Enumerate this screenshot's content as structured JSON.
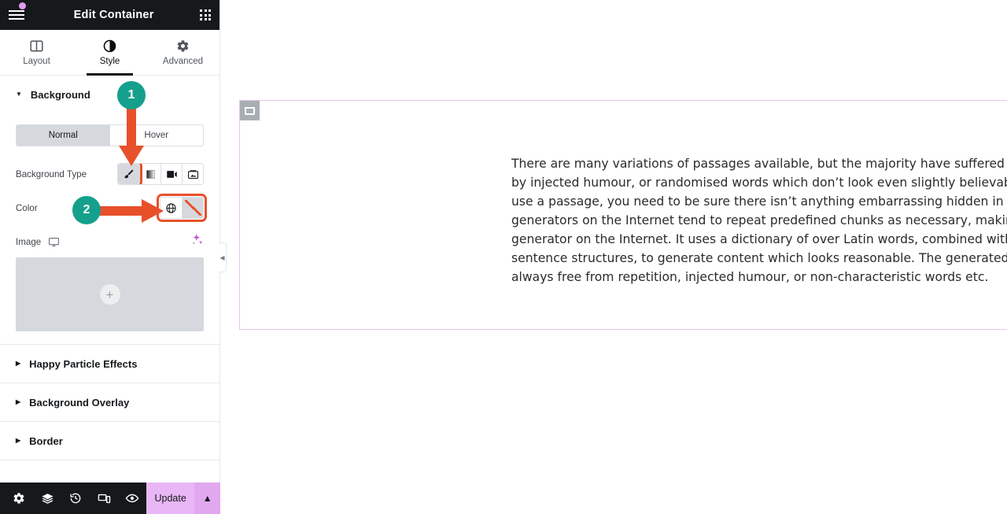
{
  "panel": {
    "header": {
      "title": "Edit Container",
      "menu_icon": "hamburger-menu-icon",
      "notification_dot_color": "#e39ded",
      "apps_icon": "grid-apps-icon"
    },
    "tabs": [
      {
        "label": "Layout",
        "icon": "layout-columns-icon",
        "active": false
      },
      {
        "label": "Style",
        "icon": "half-circle-contrast-icon",
        "active": true
      },
      {
        "label": "Advanced",
        "icon": "gear-icon",
        "active": false
      }
    ],
    "sections": [
      {
        "label": "Background",
        "expanded": true
      },
      {
        "label": "Happy Particle Effects",
        "expanded": false
      },
      {
        "label": "Background Overlay",
        "expanded": false
      },
      {
        "label": "Border",
        "expanded": false
      }
    ],
    "background": {
      "state_switch": {
        "options": [
          "Normal",
          "Hover"
        ],
        "selected": "Normal"
      },
      "background_type": {
        "label": "Background Type",
        "options": [
          {
            "name": "classic",
            "icon": "paint-brush-icon",
            "selected": true
          },
          {
            "name": "gradient",
            "icon": "gradient-square-icon",
            "selected": false
          },
          {
            "name": "video",
            "icon": "video-camera-icon",
            "selected": false
          },
          {
            "name": "slideshow",
            "icon": "image-slideshow-icon",
            "selected": false
          }
        ]
      },
      "color": {
        "label": "Color",
        "globals_icon": "globe-icon",
        "swatch_value": "none",
        "swatch_slash_color": "#e8502a"
      },
      "image": {
        "label": "Image",
        "device_icon": "desktop-monitor-icon",
        "ai_icon": "ai-sparkles-icon",
        "ai_icon_color": "#c44fd8",
        "add_icon": "plus-icon"
      }
    },
    "collapse_handle_icon": "chevron-left-icon",
    "footer": {
      "icons": [
        "settings-gear-icon",
        "navigator-layers-icon",
        "history-clock-icon",
        "responsive-devices-icon",
        "preview-eye-icon"
      ],
      "update_label": "Update",
      "update_color": "#e9b7f5",
      "update_caret_icon": "chevron-up-icon"
    }
  },
  "canvas": {
    "container": {
      "handle_icon": "container-handle-icon",
      "border_color": "#e8c4ef"
    },
    "paragraph": "There are many variations of passages available, but the majority have suffered alteration in some form, by injected humour, or randomised words which don’t look even slightly believable. If you are going to use a passage, you need to be sure there isn’t anything embarrassing hidden in the middle of text. All the generators on the Internet tend to repeat predefined chunks as necessary, making this the first true generator on the Internet. It uses a dictionary of over Latin words, combined with a handful of model sentence structures, to generate content which looks reasonable. The generated content is therefore always free from repetition, injected humour, or non-characteristic words etc."
  },
  "annotations": [
    {
      "number": "1",
      "badge_color": "#14a08c",
      "arrow_color": "#e8502a",
      "direction": "down",
      "target": "background-type-classic"
    },
    {
      "number": "2",
      "badge_color": "#14a08c",
      "arrow_color": "#e8502a",
      "direction": "right",
      "target": "color-swatch"
    }
  ]
}
